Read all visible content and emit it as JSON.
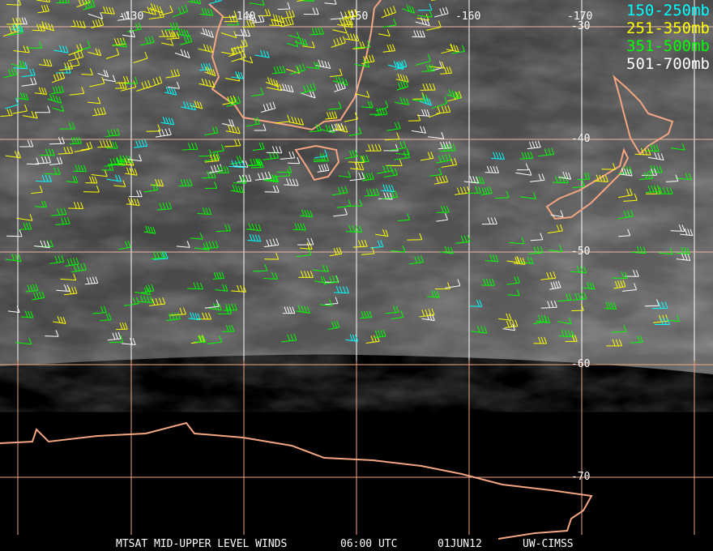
{
  "legend": {
    "items": [
      {
        "label": "150-250mb",
        "color": "#00ffff"
      },
      {
        "label": "251-350mb",
        "color": "#ffff00"
      },
      {
        "label": "351-500mb",
        "color": "#00ff00"
      },
      {
        "label": "501-700mb",
        "color": "#ffffff"
      }
    ]
  },
  "longitude_labels": [
    "-130",
    "-140",
    "-150",
    "-160",
    "-170"
  ],
  "latitude_labels": [
    "-30",
    "-40",
    "-50",
    "-60",
    "-70"
  ],
  "caption": {
    "product": "MTSAT MID-UPPER LEVEL WINDS",
    "time": "06:00 UTC",
    "date": "01JUN12",
    "source": "UW-CIMSS"
  },
  "colors": {
    "coastline": "#f4a582",
    "grid_upper": "#ffffff",
    "grid_lower": "#f4a582"
  }
}
